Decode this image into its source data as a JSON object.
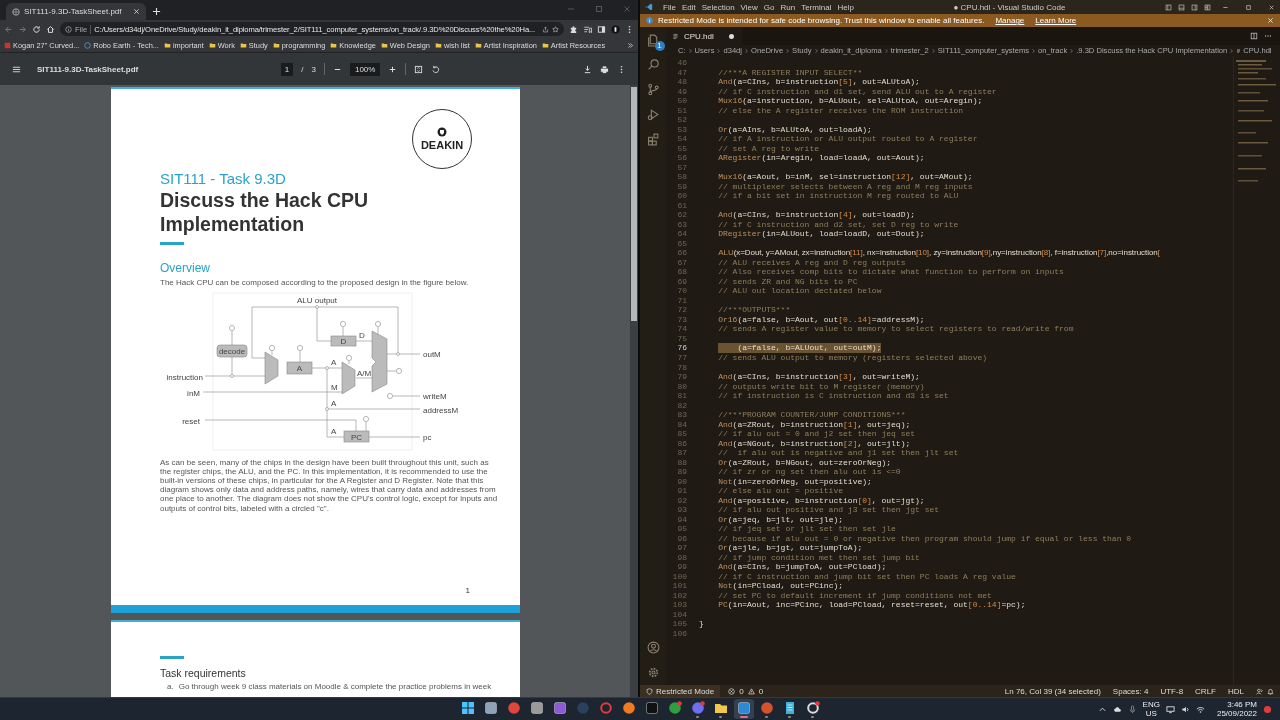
{
  "browser": {
    "tab": {
      "title": "SIT111-9.3D-TaskSheet.pdf"
    },
    "address": {
      "scheme": "File",
      "url": "C:/Users/d34dj/OneDrive/Study/deakin_it_diploma/trimester_2/SIT111_computer_systems/on_track/.9.3D%20Discuss%20the%20Ha..."
    },
    "bookmarks": [
      {
        "label": "Kogan 27\" Curved...",
        "kind": "site"
      },
      {
        "label": "Robo Earth - Tech...",
        "kind": "wordpress"
      },
      {
        "label": "important",
        "kind": "folder"
      },
      {
        "label": "Work",
        "kind": "folder"
      },
      {
        "label": "Study",
        "kind": "folder"
      },
      {
        "label": "programming",
        "kind": "folder"
      },
      {
        "label": "Knowledge",
        "kind": "folder"
      },
      {
        "label": "Web Design",
        "kind": "folder"
      },
      {
        "label": "wish list",
        "kind": "folder"
      },
      {
        "label": "Artist Inspiration",
        "kind": "folder"
      },
      {
        "label": "Artist Resources",
        "kind": "folder"
      }
    ],
    "pdf_toolbar": {
      "title": "SIT111-9.3D-TaskSheet.pdf",
      "page": "1",
      "separator": "/",
      "pages": "3",
      "zoom": "100%"
    }
  },
  "pdf": {
    "page1": {
      "logo": "DEAKIN",
      "subtitle": "SIT111 - Task 9.3D",
      "title": "Discuss the Hack CPU Implementation",
      "section": "Overview",
      "intro": "The Hack CPU can be composed according to the proposed design in the figure below.",
      "figure_labels": [
        "ALU output",
        "instruction",
        "inM",
        "reset",
        "outM",
        "writeM",
        "addressM",
        "pc",
        "decode",
        "A",
        "D",
        "PC",
        "A",
        "M",
        "A/M",
        "D",
        "A",
        "A"
      ],
      "body": "As can be seen, many of the chips in the design have been built throughout this unit, such as the register chips, the ALU, and the PC. In this implementation, it is recommended to use the built-in versions of these chips, in particular for the A Register and D Register. Note that this diagram shows only data and address paths, namely, wires that carry data and addresses from one place to another. The diagram does not show the CPU's control logic, except for inputs and outputs of control bits, labeled with a circled \"c\".",
      "page_number": "1"
    },
    "page2": {
      "heading": "Task requirements",
      "items": [
        {
          "marker": "a.",
          "text": "Go through week 9 class materials on Moodle & complete the practice problems in week"
        }
      ]
    }
  },
  "vscode": {
    "menu": [
      "File",
      "Edit",
      "Selection",
      "View",
      "Go",
      "Run",
      "Terminal",
      "Help"
    ],
    "title": "● CPU.hdl - Visual Studio Code",
    "banner": {
      "message": "Restricted Mode is intended for safe code browsing. Trust this window to enable all features.",
      "links": [
        "Manage",
        "Learn More"
      ]
    },
    "explorer_badge": "1",
    "tab": {
      "label": "CPU.hdl",
      "modified": true
    },
    "breadcrumbs": [
      "C:",
      "Users",
      "d34dj",
      "OneDrive",
      "Study",
      "deakin_it_diploma",
      "trimester_2",
      "SIT111_computer_systems",
      "on_track",
      ".9.3D Discuss the Hack CPU Implementation",
      "CPU.hdl"
    ],
    "lines": [
      {
        "number": "46",
        "selected": false
      },
      {
        "number": "47",
        "text": "    //***A REGISTER INPUT SELECT**",
        "selected": false
      },
      {
        "number": "48",
        "text": "    And(a=CIns, b=instruction[5], out=ALUtoA);",
        "selected": false
      },
      {
        "number": "49",
        "text": "    // if C instruction and d1 set, send ALU out to A register",
        "selected": false
      },
      {
        "number": "50",
        "text": "    Mux16(a=instruction, b=ALUout, sel=ALUtoA, out=Aregin);",
        "selected": false
      },
      {
        "number": "51",
        "text": "    // else the A register receives the ROM instruction",
        "selected": false
      },
      {
        "number": "52",
        "selected": false
      },
      {
        "number": "53",
        "text": "    Or(a=AIns, b=ALUtoA, out=loadA);",
        "selected": false
      },
      {
        "number": "54",
        "text": "    // if A instruction or ALU output routed to A register",
        "selected": false
      },
      {
        "number": "55",
        "text": "    // set A reg to write",
        "selected": false
      },
      {
        "number": "56",
        "text": "    ARegister(in=Aregin, load=loadA, out=Aout);",
        "selected": false
      },
      {
        "number": "57",
        "selected": false
      },
      {
        "number": "58",
        "text": "    Mux16(a=Aout, b=inM, sel=instruction[12], out=AMout);",
        "selected": false
      },
      {
        "number": "59",
        "text": "    // multiplexer selects between A reg and M reg inputs",
        "selected": false
      },
      {
        "number": "60",
        "text": "    // if a bit set in instruction M reg routed to ALU",
        "selected": false
      },
      {
        "number": "61",
        "selected": false
      },
      {
        "number": "62",
        "text": "    And(a=CIns, b=instruction[4], out=loadD);",
        "selected": false
      },
      {
        "number": "63",
        "text": "    // if C instruction and d2 set, set D reg to write",
        "selected": false
      },
      {
        "number": "64",
        "text": "    DRegister(in=ALUout, load=loadD, out=Dout);",
        "selected": false
      },
      {
        "number": "65",
        "selected": false
      },
      {
        "number": "66",
        "text": "    ALU(x=Dout, y=AMout, zx=instruction[11], nx=instruction[10], zy=instruction[9],ny=instruction[8], f=instruction[7],no=instruction[",
        "selected": false
      },
      {
        "number": "67",
        "text": "    // ALU receives A reg and D reg outputs",
        "selected": false
      },
      {
        "number": "68",
        "text": "    // Also receives comp bits to dictate what function to perform on inputs",
        "selected": false
      },
      {
        "number": "69",
        "text": "    // sends ZR and NG bits to PC",
        "selected": false
      },
      {
        "number": "70",
        "text": "    // ALU out location dectated below",
        "selected": false
      },
      {
        "number": "71",
        "selected": false
      },
      {
        "number": "72",
        "text": "    //***OUTPUTS***",
        "selected": false
      },
      {
        "number": "73",
        "text": "    Or16(a=false, b=Aout, out[0..14]=addressM);",
        "selected": false
      },
      {
        "number": "74",
        "text": "    // sends A register value to memory to select registers to read/write from",
        "selected": false
      },
      {
        "number": "75",
        "selected": false
      },
      {
        "number": "76",
        "text": "        (a=false, b=ALUout, out=outM);",
        "selected": true
      },
      {
        "number": "77",
        "text": "    // sends ALU output to memory (registers selected above)",
        "selected": false
      },
      {
        "number": "78",
        "selected": false
      },
      {
        "number": "79",
        "text": "    And(a=CIns, b=instruction[3], out=writeM);",
        "selected": false
      },
      {
        "number": "80",
        "text": "    // outputs write bit to M register (memory)",
        "selected": false
      },
      {
        "number": "81",
        "text": "    // if instruction is C instruction and d3 is set",
        "selected": false
      },
      {
        "number": "82",
        "selected": false
      },
      {
        "number": "83",
        "text": "    //***PROGRAM COUNTER/JUMP CONDITIONS***",
        "selected": false
      },
      {
        "number": "84",
        "text": "    And(a=ZRout, b=instruction[1], out=jeq);",
        "selected": false
      },
      {
        "number": "85",
        "text": "    // if alu out = 0 and j2 set then jeq set",
        "selected": false
      },
      {
        "number": "86",
        "text": "    And(a=NGout, b=instruction[2], out=jlt);",
        "selected": false
      },
      {
        "number": "87",
        "text": "    //  if alu out is negative and j1 set then jlt set",
        "selected": false
      },
      {
        "number": "88",
        "text": "    Or(a=ZRout, b=NGout, out=zeroOrNeg);",
        "selected": false
      },
      {
        "number": "89",
        "text": "    // if zr or ng set then alu out is <=0",
        "selected": false
      },
      {
        "number": "90",
        "text": "    Not(in=zeroOrNeg, out=positive);",
        "selected": false
      },
      {
        "number": "91",
        "text": "    // else alu out = positive",
        "selected": false
      },
      {
        "number": "92",
        "text": "    And(a=positive, b=instruction[0], out=jgt);",
        "selected": false
      },
      {
        "number": "93",
        "text": "    // if alu out positive and j3 set then jgt set",
        "selected": false
      },
      {
        "number": "94",
        "text": "    Or(a=jeq, b=jlt, out=jle);",
        "selected": false
      },
      {
        "number": "95",
        "text": "    // if jeq set or jlt set then set jle",
        "selected": false
      },
      {
        "number": "96",
        "text": "    // because if alu out = 0 or negative then program should jump if equal or less than 0",
        "selected": false
      },
      {
        "number": "97",
        "text": "    Or(a=jle, b=jgt, out=jumpToA);",
        "selected": false
      },
      {
        "number": "98",
        "text": "    // if jump condition met then set jump bit",
        "selected": false
      },
      {
        "number": "99",
        "text": "    And(a=CIns, b=jumpToA, out=PCload);",
        "selected": false
      },
      {
        "number": "100",
        "text": "    // if C instruction and jump bit set then PC loads A reg value",
        "selected": false
      },
      {
        "number": "101",
        "text": "    Not(in=PCload, out=PCinc);",
        "selected": false
      },
      {
        "number": "102",
        "text": "    // set PC to default increment if jump conditions not met",
        "selected": false
      },
      {
        "number": "103",
        "text": "    PC(in=Aout, inc=PCinc, load=PCload, reset=reset, out[0..14]=pc);",
        "selected": false
      },
      {
        "number": "104",
        "selected": false
      },
      {
        "number": "105",
        "text": "}",
        "selected": false
      },
      {
        "number": "106",
        "selected": false
      }
    ],
    "status": {
      "mode": "Restricted Mode",
      "errors": "0",
      "warnings": "0",
      "items": [
        "Ln 76, Col 39 (34 selected)",
        "Spaces: 4",
        "UTF-8",
        "CRLF",
        "HDL"
      ]
    }
  },
  "taskbar": {
    "apps": [
      {
        "kind": "start",
        "selected": false,
        "running": false,
        "badge": false
      },
      {
        "kind": "window",
        "selected": false,
        "running": false,
        "badge": false
      },
      {
        "kind": "chrome",
        "selected": false,
        "running": false,
        "badge": false
      },
      {
        "kind": "gray",
        "selected": false,
        "running": false,
        "badge": false
      },
      {
        "kind": "purple",
        "selected": false,
        "running": false,
        "badge": false
      },
      {
        "kind": "steam",
        "selected": false,
        "running": false,
        "badge": false
      },
      {
        "kind": "ring",
        "selected": false,
        "running": false,
        "badge": false
      },
      {
        "kind": "orange",
        "selected": false,
        "running": false,
        "badge": false
      },
      {
        "kind": "black",
        "selected": false,
        "running": false,
        "badge": false
      },
      {
        "kind": "green",
        "selected": false,
        "running": false,
        "badge": true
      },
      {
        "kind": "chat",
        "selected": false,
        "running": true,
        "badge": true
      },
      {
        "kind": "folder",
        "selected": false,
        "running": true,
        "badge": false
      },
      {
        "kind": "editor",
        "selected": true,
        "running": true,
        "badge": false
      },
      {
        "kind": "slides",
        "selected": false,
        "running": true,
        "badge": false
      },
      {
        "kind": "notes",
        "selected": false,
        "running": true,
        "badge": false
      },
      {
        "kind": "capture",
        "selected": false,
        "running": true,
        "badge": true
      }
    ],
    "tray": {
      "language": "ENG",
      "region": "US",
      "time": "3:46 PM",
      "date": "25/09/2022"
    }
  }
}
